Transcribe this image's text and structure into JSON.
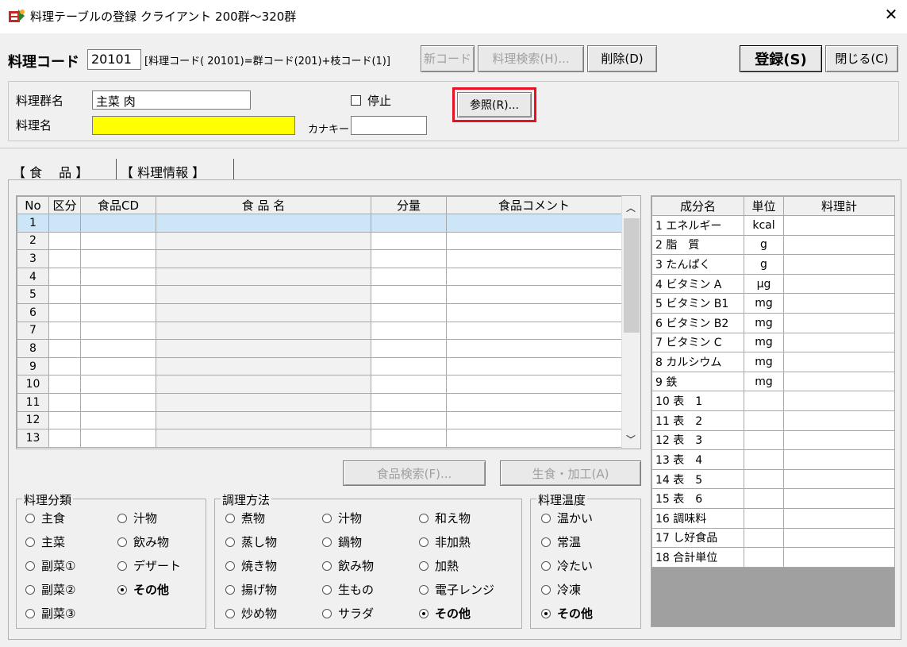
{
  "window": {
    "title": "料理テーブルの登録 クライアント 200群～320群",
    "close": "✕"
  },
  "toolbar": {
    "code_label": "料理コード",
    "code_value": "20101",
    "code_hint": "[料理コード( 20101)=群コード(201)+枝コード(1)]",
    "new_code": "新コード",
    "search": "料理検索(H)...",
    "delete": "削除(D)",
    "register": "登録(S)",
    "close": "閉じる(C)"
  },
  "form": {
    "group_label": "料理群名",
    "group_value": "主菜 肉",
    "stop_label": "停止",
    "ref_button": "参照(R)...",
    "name_label": "料理名",
    "name_value": "",
    "kana_label": "カナキー",
    "kana_value": ""
  },
  "tabs": {
    "foods": "【 食　 品 】",
    "info": "【 料理情報 】"
  },
  "grid": {
    "headers": [
      "No",
      "区分",
      "食品CD",
      "食 品 名",
      "分量",
      "食品コメント"
    ],
    "rows": [
      "1",
      "2",
      "3",
      "4",
      "5",
      "6",
      "7",
      "8",
      "9",
      "10",
      "11",
      "12",
      "13"
    ]
  },
  "buttons": {
    "food_search": "食品検索(F)...",
    "raw_process": "生食・加工(A)"
  },
  "dish_class": {
    "title": "料理分類",
    "options": [
      "主食",
      "汁物",
      "主菜",
      "飲み物",
      "副菜①",
      "デザート",
      "副菜②",
      "その他",
      "副菜③"
    ],
    "selected": "その他"
  },
  "cook_method": {
    "title": "調理方法",
    "options": [
      "煮物",
      "汁物",
      "和え物",
      "蒸し物",
      "鍋物",
      "非加熱",
      "焼き物",
      "飲み物",
      "加熱",
      "揚げ物",
      "生もの",
      "電子レンジ",
      "炒め物",
      "サラダ",
      "その他"
    ],
    "selected": "その他"
  },
  "temperature": {
    "title": "料理温度",
    "options": [
      "温かい",
      "常温",
      "冷たい",
      "冷凍",
      "その他"
    ],
    "selected": "その他"
  },
  "nutrients": {
    "headers": [
      "成分名",
      "単位",
      "料理計"
    ],
    "rows": [
      {
        "name": "1 エネルギー",
        "unit": "kcal"
      },
      {
        "name": "2 脂　質",
        "unit": "g"
      },
      {
        "name": "3 たんぱく",
        "unit": "g"
      },
      {
        "name": "4 ビタミン A",
        "unit": "μg"
      },
      {
        "name": "5 ビタミン B1",
        "unit": "mg"
      },
      {
        "name": "6 ビタミン B2",
        "unit": "mg"
      },
      {
        "name": "7 ビタミン C",
        "unit": "mg"
      },
      {
        "name": "8 カルシウム",
        "unit": "mg"
      },
      {
        "name": "9 鉄",
        "unit": "mg"
      },
      {
        "name": "10 表　1",
        "unit": ""
      },
      {
        "name": "11 表　2",
        "unit": ""
      },
      {
        "name": "12 表　3",
        "unit": ""
      },
      {
        "name": "13 表　4",
        "unit": ""
      },
      {
        "name": "14 表　5",
        "unit": ""
      },
      {
        "name": "15 表　6",
        "unit": ""
      },
      {
        "name": "16 調味料",
        "unit": ""
      },
      {
        "name": "17 し好食品",
        "unit": ""
      },
      {
        "name": "18 合計単位",
        "unit": ""
      }
    ]
  },
  "colors": {
    "name_field": "#ffff00",
    "highlight": "#e81123",
    "selected_row": "#cce6f7"
  },
  "icons": {
    "app": "app-icon",
    "close": "close-icon",
    "up": "chevron-up-icon",
    "down": "chevron-down-icon"
  }
}
